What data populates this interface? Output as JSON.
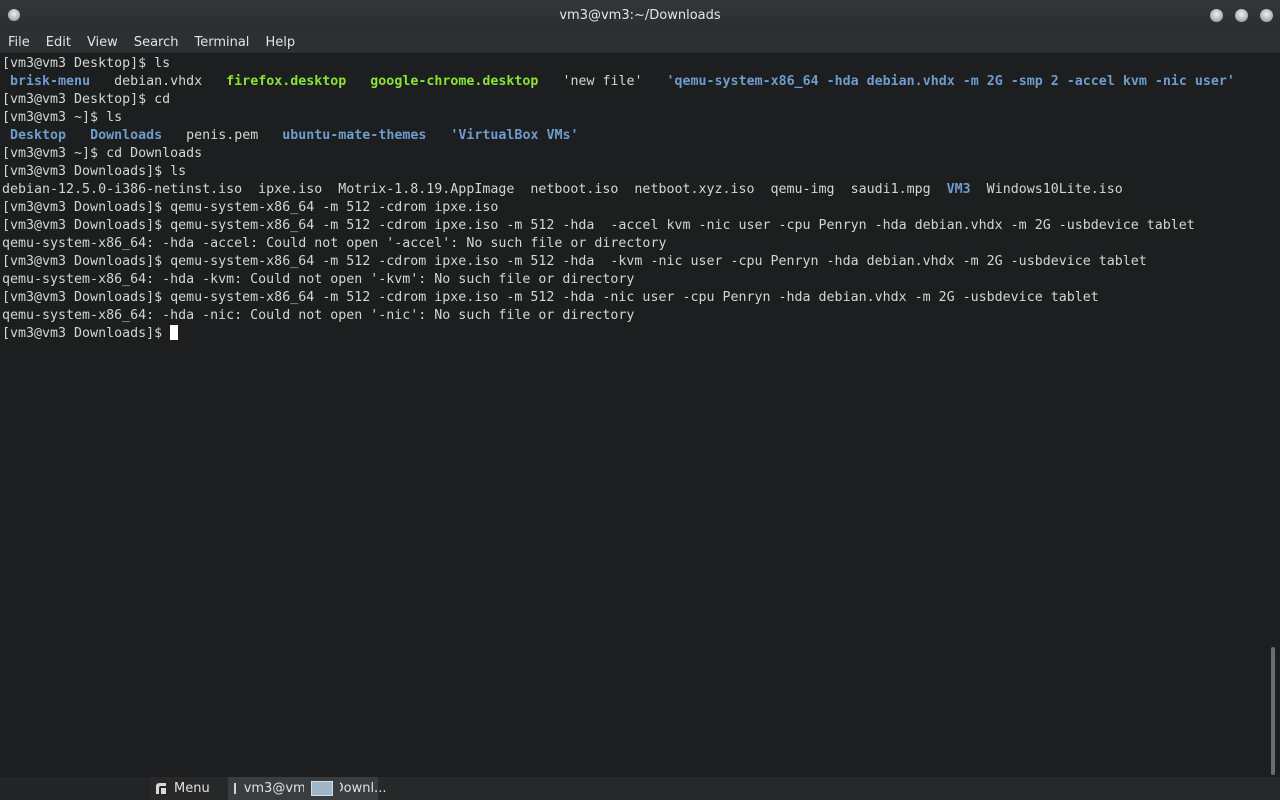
{
  "window": {
    "title": "vm3@vm3:~/Downloads"
  },
  "menubar": {
    "items": [
      "File",
      "Edit",
      "View",
      "Search",
      "Terminal",
      "Help"
    ]
  },
  "terminal": {
    "lines": [
      [
        {
          "t": "[vm3@vm3 Desktop]$ ls"
        }
      ],
      [
        {
          "t": " "
        },
        {
          "t": "brisk-menu",
          "c": "blue"
        },
        {
          "t": "   debian.vhdx   "
        },
        {
          "t": "firefox.desktop",
          "c": "green"
        },
        {
          "t": "   "
        },
        {
          "t": "google-chrome.desktop",
          "c": "green"
        },
        {
          "t": "   'new file'   "
        },
        {
          "t": "'qemu-system-x86_64 -hda debian.vhdx -m 2G -smp 2 -accel kvm -nic user'",
          "c": "blue"
        }
      ],
      [
        {
          "t": "[vm3@vm3 Desktop]$ cd"
        }
      ],
      [
        {
          "t": "[vm3@vm3 ~]$ ls"
        }
      ],
      [
        {
          "t": " "
        },
        {
          "t": "Desktop",
          "c": "blue"
        },
        {
          "t": "   "
        },
        {
          "t": "Downloads",
          "c": "blue"
        },
        {
          "t": "   penis.pem   "
        },
        {
          "t": "ubuntu-mate-themes",
          "c": "blue"
        },
        {
          "t": "   "
        },
        {
          "t": "'VirtualBox VMs'",
          "c": "blue"
        }
      ],
      [
        {
          "t": "[vm3@vm3 ~]$ cd Downloads"
        }
      ],
      [
        {
          "t": "[vm3@vm3 Downloads]$ ls"
        }
      ],
      [
        {
          "t": "debian-12.5.0-i386-netinst.iso  ipxe.iso  Motrix-1.8.19.AppImage  netboot.iso  netboot.xyz.iso  qemu-img  saudi1.mpg  "
        },
        {
          "t": "VM3",
          "c": "blue"
        },
        {
          "t": "  Windows10Lite.iso"
        }
      ],
      [
        {
          "t": "[vm3@vm3 Downloads]$ qemu-system-x86_64 -m 512 -cdrom ipxe.iso"
        }
      ],
      [
        {
          "t": "[vm3@vm3 Downloads]$ qemu-system-x86_64 -m 512 -cdrom ipxe.iso -m 512 -hda  -accel kvm -nic user -cpu Penryn -hda debian.vhdx -m 2G -usbdevice tablet"
        }
      ],
      [
        {
          "t": "qemu-system-x86_64: -hda -accel: Could not open '-accel': No such file or directory"
        }
      ],
      [
        {
          "t": "[vm3@vm3 Downloads]$ qemu-system-x86_64 -m 512 -cdrom ipxe.iso -m 512 -hda  -kvm -nic user -cpu Penryn -hda debian.vhdx -m 2G -usbdevice tablet"
        }
      ],
      [
        {
          "t": "qemu-system-x86_64: -hda -kvm: Could not open '-kvm': No such file or directory"
        }
      ],
      [
        {
          "t": "[vm3@vm3 Downloads]$ qemu-system-x86_64 -m 512 -cdrom ipxe.iso -m 512 -hda -nic user -cpu Penryn -hda debian.vhdx -m 2G -usbdevice tablet"
        }
      ],
      [
        {
          "t": "qemu-system-x86_64: -hda -nic: Could not open '-nic': No such file or directory"
        }
      ]
    ],
    "prompt": "[vm3@vm3 Downloads]$ ",
    "scroll_position": 1.0
  },
  "taskbar": {
    "menu_label": "Menu",
    "task_label": "vm3@vm3:~/Downl...",
    "workspace_active": 1
  },
  "colors": {
    "blue": "#6f9ccc",
    "green": "#8ae234",
    "text": "#d3d7cf",
    "background": "#1c1e20"
  },
  "icons": [
    "window-menu-icon",
    "minimize-icon",
    "maximize-icon",
    "close-icon",
    "mate-menu-icon",
    "terminal-icon"
  ]
}
